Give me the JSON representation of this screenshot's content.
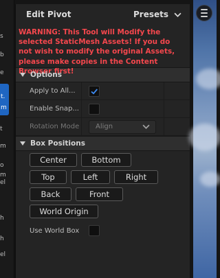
{
  "left_fragments": [
    "s",
    "b",
    "e",
    "t",
    "m",
    "o",
    "m",
    "l",
    "el",
    "h",
    "h",
    "el"
  ],
  "left_selected": [
    "t.",
    "m"
  ],
  "panel": {
    "title": "Edit Pivot",
    "presets_label": "Presets"
  },
  "warning": "WARNING: This Tool will Modify the selected StaticMesh Assets! If you do not wish to modify the original Assets, please make copies in the Content Browser first!",
  "options": {
    "header": "Options",
    "apply_to_all_label": "Apply to All...",
    "apply_to_all_checked": true,
    "enable_snap_label": "Enable Snap...",
    "enable_snap_checked": false,
    "rotation_mode_label": "Rotation Mode",
    "rotation_mode_value": "Align"
  },
  "box_positions": {
    "header": "Box Positions",
    "center": "Center",
    "bottom": "Bottom",
    "top": "Top",
    "left": "Left",
    "right": "Right",
    "back": "Back",
    "front": "Front",
    "world_origin": "World Origin",
    "use_world_box_label": "Use World Box",
    "use_world_box_checked": false
  },
  "colors": {
    "accent": "#1f66c2",
    "warning": "#f5474d",
    "panel_bg": "#242424"
  }
}
